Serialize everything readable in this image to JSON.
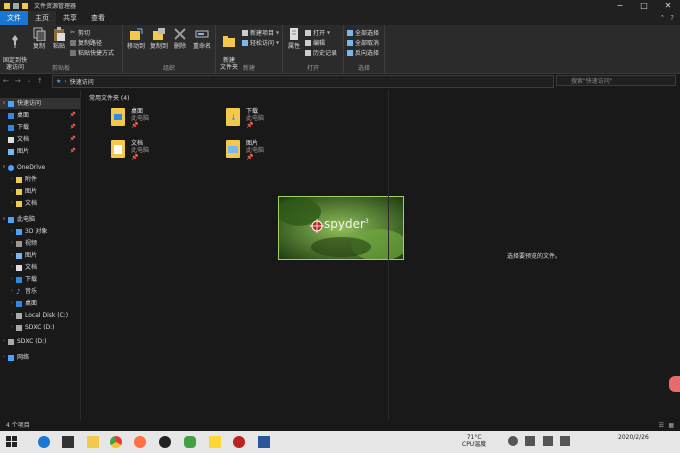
{
  "window": {
    "title": "文件资源管理器"
  },
  "tabs": [
    "文件",
    "主页",
    "共享",
    "查看"
  ],
  "ribbon": {
    "pin_quick_access": "固定到快\n速访问",
    "copy": "复制",
    "paste": "粘贴",
    "cut": "剪切",
    "copy_path": "复制路径",
    "paste_shortcut": "粘贴快捷方式",
    "clipboard_label": "剪贴板",
    "move_to": "移动到",
    "copy_to": "复制到",
    "delete": "删除",
    "rename": "重命名",
    "organize_label": "组织",
    "new_folder": "新建\n文件夹",
    "new_item": "新建项目",
    "easy_access": "轻松访问",
    "new_label": "新建",
    "properties": "属性",
    "open": "打开",
    "edit": "编辑",
    "history": "历史记录",
    "open_label": "打开",
    "select_all": "全部选择",
    "select_none": "全部取消",
    "invert_selection": "反向选择",
    "select_label": "选择"
  },
  "address": {
    "path": "快速访问",
    "search_placeholder": "搜索\"快速访问\""
  },
  "sidebar": {
    "quick_access": "快速访问",
    "qa_items": [
      "桌面",
      "下载",
      "文档",
      "图片"
    ],
    "onedrive": "OneDrive",
    "onedrive_items": [
      "附件",
      "图片",
      "文档"
    ],
    "this_pc": "此电脑",
    "pc_items": [
      "3D 对象",
      "视频",
      "图片",
      "文档",
      "下载",
      "音乐",
      "桌面",
      "Local Disk (C:)",
      "SDXC (D:)"
    ],
    "sdxc": "SDXC (D:)",
    "network": "网络"
  },
  "content": {
    "section_title": "常用文件夹 (4)",
    "folders": [
      {
        "name": "桌面",
        "location": "此电脑"
      },
      {
        "name": "下载",
        "location": "此电脑"
      },
      {
        "name": "文档",
        "location": "此电脑"
      },
      {
        "name": "图片",
        "location": "此电脑"
      }
    ]
  },
  "splash": {
    "logo_text": "spyder",
    "version": "3"
  },
  "preview_message": "选择要预览的文件。",
  "status": {
    "item_count": "4 个项目"
  },
  "taskbar": {
    "temperature": "71°C",
    "cpu_label": "CPU温度",
    "time": "2020/2/26"
  },
  "colors": {
    "accent": "#1976d2",
    "folder": "#f2c94c",
    "background": "#191919"
  }
}
